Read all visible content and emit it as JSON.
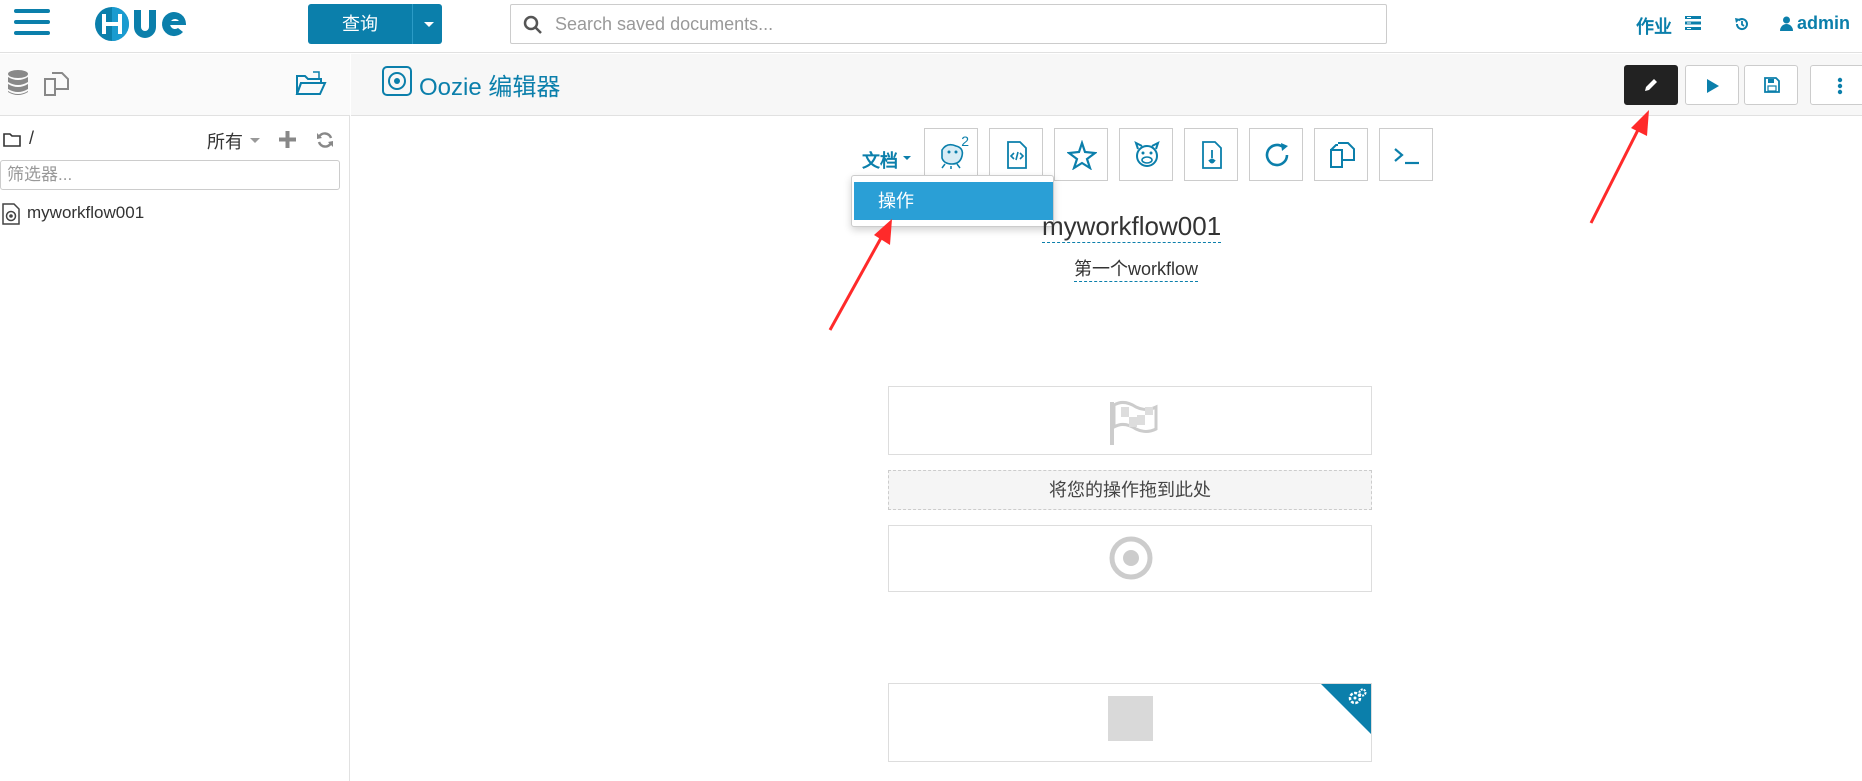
{
  "topbar": {
    "logo_text": "HUE",
    "query_button": "查询",
    "search_placeholder": "Search saved documents...",
    "jobs_label": "作业",
    "user_label": "admin"
  },
  "sidebar": {
    "path": "/",
    "filter_all_label": "所有",
    "filter_placeholder": "筛选器...",
    "files": [
      {
        "name": "myworkflow001",
        "icon": "oozie-workflow-icon"
      }
    ]
  },
  "editor": {
    "title": "Oozie 编辑器",
    "actions": [
      "edit-icon",
      "play-icon",
      "save-icon",
      "more-vertical-icon"
    ]
  },
  "toolbar": {
    "docs_menu_label": "文档",
    "dropdown_items": [
      "操作"
    ],
    "tools": [
      {
        "name": "hive-tool",
        "badge": "2"
      },
      {
        "name": "script-tool"
      },
      {
        "name": "spark-tool"
      },
      {
        "name": "pig-tool"
      },
      {
        "name": "java-tool"
      },
      {
        "name": "sub-workflow-tool"
      },
      {
        "name": "copy-tool"
      },
      {
        "name": "shell-tool"
      }
    ]
  },
  "workflow": {
    "name": "myworkflow001",
    "description": "第一个workflow",
    "drop_hint": "将您的操作拖到此处"
  },
  "colors": {
    "accent": "#0b7fab",
    "highlight": "#2a9fd6",
    "annotation_arrow": "#ff2a2a"
  }
}
